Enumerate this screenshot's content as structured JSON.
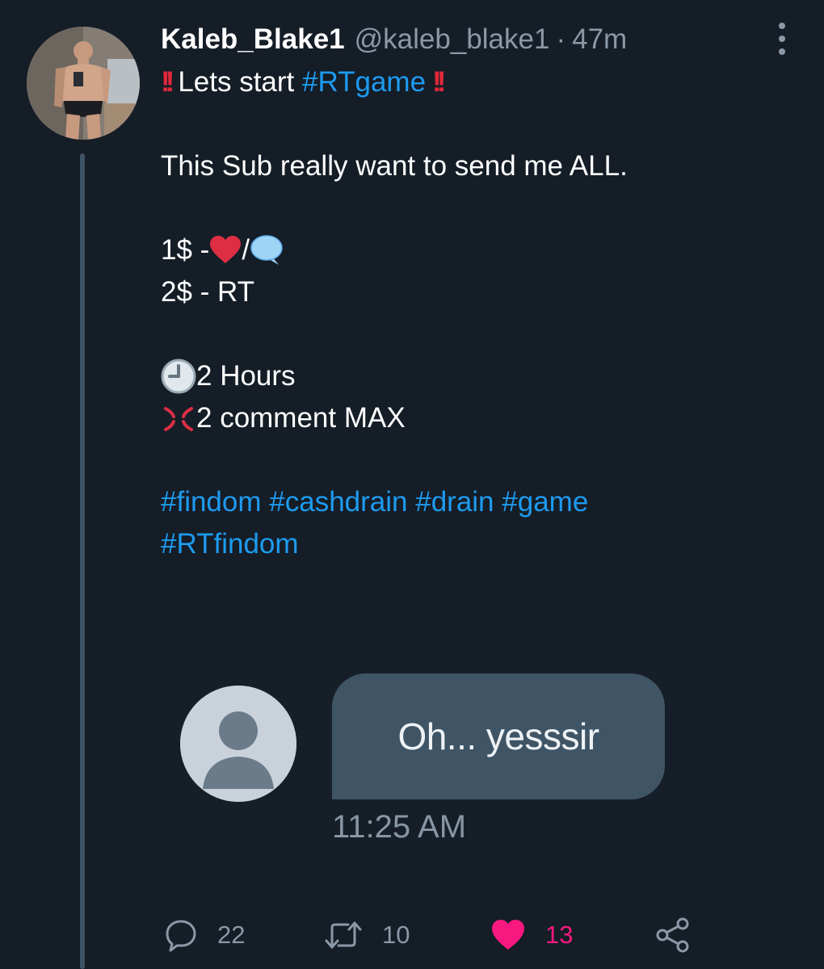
{
  "tweet": {
    "author": {
      "name": "Kaleb_Blake1",
      "handle": "@kaleb_blake1",
      "avatar_icon": "profile-photo"
    },
    "separator": "·",
    "time_ago": "47m",
    "more_icon": "more-vertical-icon",
    "lines": {
      "intro_text": "Lets start",
      "intro_hashtag": "#RTgame",
      "sub_line": "This Sub really want to send me ALL.",
      "price_one": "1$ -",
      "price_one_sep": "/",
      "price_two": "2$ - RT",
      "duration": "2 Hours",
      "comment_limit": "2 comment MAX"
    },
    "hashtags_row1": [
      "#findom",
      "#cashdrain",
      "#drain",
      "#game"
    ],
    "hashtags_row2": [
      "#RTfindom"
    ],
    "media": {
      "message": "Oh... yesssir",
      "time": "11:25 AM",
      "avatar_icon": "default-user-icon"
    },
    "actions": {
      "reply_count": "22",
      "retweet_count": "10",
      "like_count": "13",
      "liked": true,
      "reply_icon": "reply-icon",
      "retweet_icon": "retweet-icon",
      "like_icon": "heart-icon",
      "share_icon": "share-icon"
    },
    "colors": {
      "background": "#151d27",
      "link": "#1d9bf0",
      "muted": "#8b98a5",
      "like": "#f91880",
      "thread_line": "#3d5466"
    }
  }
}
